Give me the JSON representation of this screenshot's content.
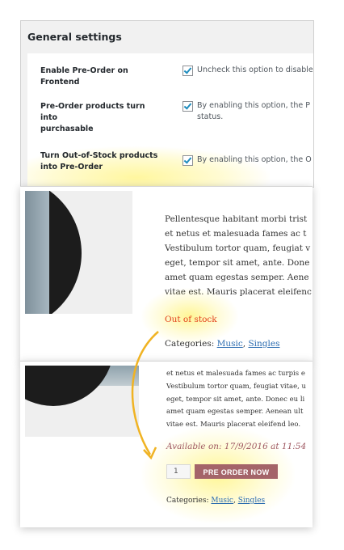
{
  "settings": {
    "title": "General settings",
    "rows": [
      {
        "label_line1": "Enable Pre-Order on Frontend",
        "label_line2": "",
        "desc_line1": "Uncheck this option to disable",
        "desc_line2": ""
      },
      {
        "label_line1": "Pre-Order products turn into",
        "label_line2": "purchasable",
        "desc_line1": "By enabling this option, the P",
        "desc_line2": "status."
      },
      {
        "label_line1": "Turn Out-of-Stock products",
        "label_line2": "into Pre-Order",
        "desc_line1": "By enabling this option, the O",
        "desc_line2": ""
      }
    ]
  },
  "product_before": {
    "description_lines": [
      "Pellentesque habitant morbi trist",
      "et netus et malesuada fames ac t",
      "Vestibulum tortor quam, feugiat v",
      "eget, tempor sit amet, ante. Done",
      "amet quam egestas semper. Aene",
      "vitae est. Mauris placerat eleifenc"
    ],
    "stock_status": "Out of stock",
    "categories_label": "Categories:",
    "categories": [
      "Music",
      "Singles"
    ]
  },
  "product_after": {
    "description_lines": [
      "et netus et malesuada fames ac turpis e",
      "Vestibulum tortor quam, feugiat vitae, u",
      "eget, tempor sit amet, ante. Donec eu li",
      "amet quam egestas semper. Aenean ult",
      "vitae est. Mauris placerat eleifend leo."
    ],
    "availability": "Available on: 17/9/2016 at 11:54",
    "quantity": "1",
    "button_label": "PRE ORDER NOW",
    "categories_label": "Categories:",
    "categories": [
      "Music",
      "Singles"
    ]
  },
  "colors": {
    "out_of_stock": "#e2401c",
    "button": "#a46469",
    "arrow": "#f0b323",
    "checkbox_tick": "#1e8cbe",
    "link": "#2b6cb0"
  }
}
